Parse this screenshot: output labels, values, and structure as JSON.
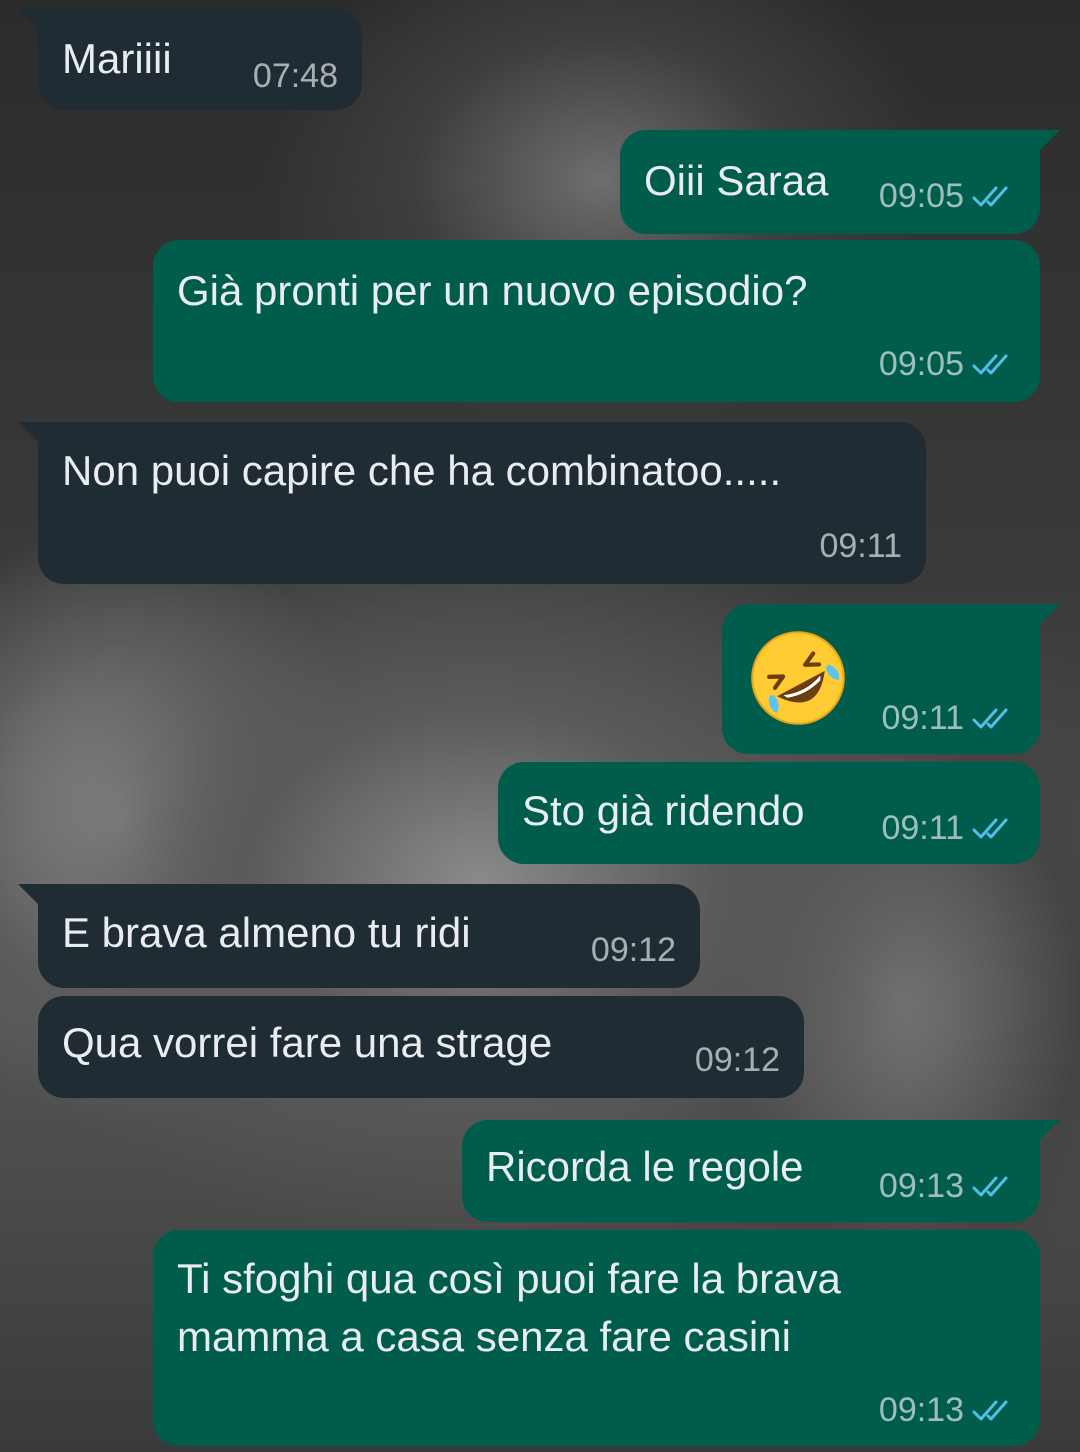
{
  "conversation": {
    "messages": [
      {
        "direction": "incoming",
        "text": "Mariiii",
        "time": "07:48"
      },
      {
        "direction": "outgoing",
        "text": "Oiii Saraa",
        "time": "09:05",
        "status": "read"
      },
      {
        "direction": "outgoing",
        "text": "Già pronti per un nuovo episodio?",
        "time": "09:05",
        "status": "read"
      },
      {
        "direction": "incoming",
        "text": "Non puoi capire che ha combinatoo.....",
        "time": "09:11"
      },
      {
        "direction": "outgoing",
        "text": "",
        "emoji": "rolling-on-the-floor-laughing",
        "time": "09:11",
        "status": "read"
      },
      {
        "direction": "outgoing",
        "text": "Sto già ridendo",
        "time": "09:11",
        "status": "read"
      },
      {
        "direction": "incoming",
        "text": "E brava almeno tu ridi",
        "time": "09:12"
      },
      {
        "direction": "incoming",
        "text": "Qua vorrei fare una strage",
        "time": "09:12"
      },
      {
        "direction": "outgoing",
        "text": "Ricorda le regole",
        "time": "09:13",
        "status": "read"
      },
      {
        "direction": "outgoing",
        "lines": [
          "Ti sfoghi qua così puoi fare la brava",
          "mamma a casa senza fare casini"
        ],
        "time": "09:13",
        "status": "read"
      }
    ]
  },
  "colors": {
    "incoming_bubble": "#202c33",
    "outgoing_bubble": "#005c4b",
    "text": "#e9edef",
    "read_ticks": "#53bdeb"
  },
  "icons": {
    "read_receipt": "double-check-icon",
    "emoji": "rolling-on-the-floor-laughing-emoji"
  }
}
